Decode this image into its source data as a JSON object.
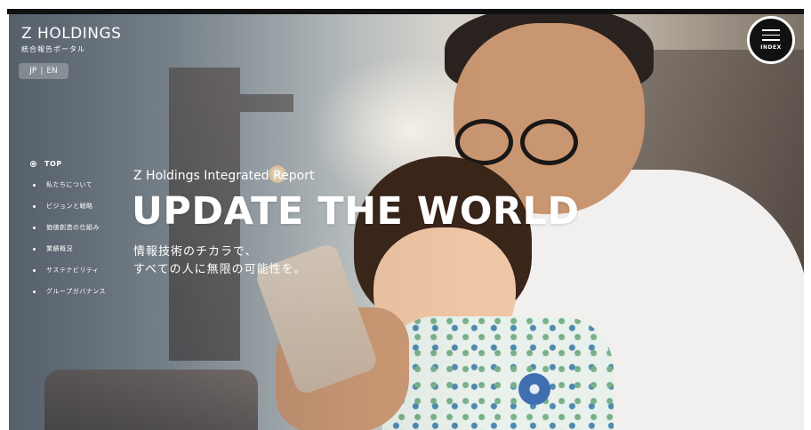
{
  "header": {
    "logo_title": "Z HOLDINGS",
    "logo_subtitle": "統合報告ポータル",
    "lang_jp": "JP",
    "lang_separator": "|",
    "lang_en": "EN"
  },
  "nav": {
    "items": [
      {
        "label": "TOP",
        "active": true
      },
      {
        "label": "私たちについて",
        "active": false
      },
      {
        "label": "ビジョンと戦略",
        "active": false
      },
      {
        "label": "価値創造の仕組み",
        "active": false
      },
      {
        "label": "業績概況",
        "active": false
      },
      {
        "label": "サステナビリティ",
        "active": false
      },
      {
        "label": "グループガバナンス",
        "active": false
      }
    ]
  },
  "hero": {
    "eyebrow": "Z Holdings Integrated Report",
    "headline": "UPDATE THE WORLD",
    "tagline_line1": "情報技術のチカラで、",
    "tagline_line2": "すべての人に無限の可能性を。"
  },
  "menu_button": {
    "label": "INDEX",
    "icon": "hamburger-icon"
  },
  "colors": {
    "menu_bg": "#111111",
    "text": "#ffffff",
    "top_border": "#111111"
  }
}
